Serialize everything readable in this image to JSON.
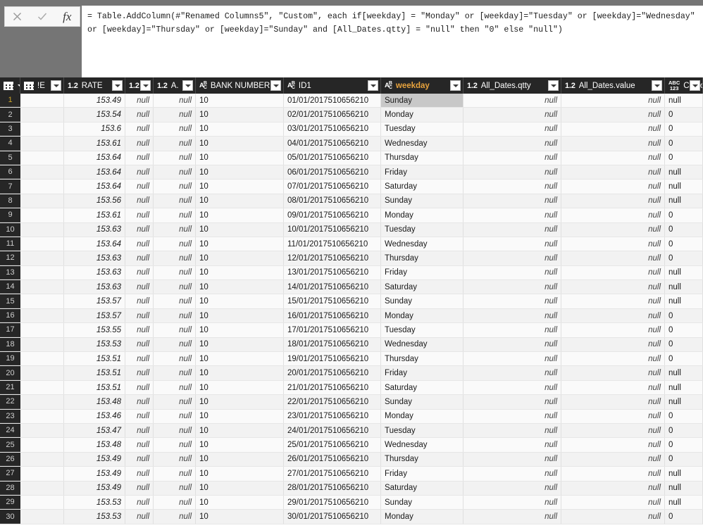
{
  "formula_bar": {
    "cancel_icon": "close-icon",
    "accept_icon": "check-icon",
    "fx_label": "fx",
    "formula": "= Table.AddColumn(#\"Renamed Columns5\", \"Custom\", each if[weekday] = \"Monday\" or [weekday]=\"Tuesday\" or [weekday]=\"Wednesday\" or [weekday]=\"Thursday\" or [weekday]=\"Sunday\" and [All_Dates.qtty] = \"null\" then \"0\" else \"null\")"
  },
  "grid": {
    "table_icon": "table-icon",
    "columns": [
      {
        "key": "rownum",
        "label": "",
        "type_badge": "",
        "width": 29,
        "align": "center",
        "selected": false,
        "dropdown": false
      },
      {
        "key": "c_date",
        "label": "!E",
        "type_badge": "table",
        "width": 62,
        "align": "left",
        "selected": false,
        "dropdown": true
      },
      {
        "key": "rate",
        "label": "RATE",
        "type_badge": "1.2",
        "width": 87,
        "align": "right",
        "selected": false,
        "dropdown": true
      },
      {
        "key": "narrow1",
        "label": "",
        "type_badge": "1.2",
        "width": 40,
        "align": "right",
        "selected": false,
        "dropdown": true
      },
      {
        "key": "narrow2",
        "label": "A.",
        "type_badge": "1.2",
        "width": 60,
        "align": "right",
        "selected": false,
        "dropdown": true
      },
      {
        "key": "bank",
        "label": "BANK NUMBER",
        "type_badge": "abc",
        "width": 125,
        "align": "left",
        "selected": false,
        "dropdown": true
      },
      {
        "key": "id1",
        "label": "ID1",
        "type_badge": "abc",
        "width": 138,
        "align": "left",
        "selected": false,
        "dropdown": true
      },
      {
        "key": "weekday",
        "label": "weekday",
        "type_badge": "abc",
        "width": 117,
        "align": "left",
        "selected": true,
        "dropdown": true
      },
      {
        "key": "qtty",
        "label": "All_Dates.qtty",
        "type_badge": "1.2",
        "width": 139,
        "align": "right",
        "selected": false,
        "dropdown": true
      },
      {
        "key": "value",
        "label": "All_Dates.value",
        "type_badge": "1.2",
        "width": 147,
        "align": "right",
        "selected": false,
        "dropdown": true
      },
      {
        "key": "custom",
        "label": "Custom",
        "type_badge": "abc123",
        "width": 54,
        "align": "left",
        "selected": false,
        "dropdown": true
      }
    ],
    "selected_cell": {
      "row": 1,
      "column": "weekday"
    },
    "rows": [
      {
        "rownum": "1",
        "c_date": "",
        "rate": "153.49",
        "narrow1": "null",
        "narrow2": "null",
        "bank": "10",
        "id1": "01/01/2017510656210",
        "weekday": "Sunday",
        "qtty": "null",
        "value": "null",
        "custom": "null"
      },
      {
        "rownum": "2",
        "c_date": "",
        "rate": "153.54",
        "narrow1": "null",
        "narrow2": "null",
        "bank": "10",
        "id1": "02/01/2017510656210",
        "weekday": "Monday",
        "qtty": "null",
        "value": "null",
        "custom": "0"
      },
      {
        "rownum": "3",
        "c_date": "",
        "rate": "153.6",
        "narrow1": "null",
        "narrow2": "null",
        "bank": "10",
        "id1": "03/01/2017510656210",
        "weekday": "Tuesday",
        "qtty": "null",
        "value": "null",
        "custom": "0"
      },
      {
        "rownum": "4",
        "c_date": "",
        "rate": "153.61",
        "narrow1": "null",
        "narrow2": "null",
        "bank": "10",
        "id1": "04/01/2017510656210",
        "weekday": "Wednesday",
        "qtty": "null",
        "value": "null",
        "custom": "0"
      },
      {
        "rownum": "5",
        "c_date": "",
        "rate": "153.64",
        "narrow1": "null",
        "narrow2": "null",
        "bank": "10",
        "id1": "05/01/2017510656210",
        "weekday": "Thursday",
        "qtty": "null",
        "value": "null",
        "custom": "0"
      },
      {
        "rownum": "6",
        "c_date": "",
        "rate": "153.64",
        "narrow1": "null",
        "narrow2": "null",
        "bank": "10",
        "id1": "06/01/2017510656210",
        "weekday": "Friday",
        "qtty": "null",
        "value": "null",
        "custom": "null"
      },
      {
        "rownum": "7",
        "c_date": "",
        "rate": "153.64",
        "narrow1": "null",
        "narrow2": "null",
        "bank": "10",
        "id1": "07/01/2017510656210",
        "weekday": "Saturday",
        "qtty": "null",
        "value": "null",
        "custom": "null"
      },
      {
        "rownum": "8",
        "c_date": "",
        "rate": "153.56",
        "narrow1": "null",
        "narrow2": "null",
        "bank": "10",
        "id1": "08/01/2017510656210",
        "weekday": "Sunday",
        "qtty": "null",
        "value": "null",
        "custom": "null"
      },
      {
        "rownum": "9",
        "c_date": "",
        "rate": "153.61",
        "narrow1": "null",
        "narrow2": "null",
        "bank": "10",
        "id1": "09/01/2017510656210",
        "weekday": "Monday",
        "qtty": "null",
        "value": "null",
        "custom": "0"
      },
      {
        "rownum": "10",
        "c_date": "",
        "rate": "153.63",
        "narrow1": "null",
        "narrow2": "null",
        "bank": "10",
        "id1": "10/01/2017510656210",
        "weekday": "Tuesday",
        "qtty": "null",
        "value": "null",
        "custom": "0"
      },
      {
        "rownum": "11",
        "c_date": "",
        "rate": "153.64",
        "narrow1": "null",
        "narrow2": "null",
        "bank": "10",
        "id1": "11/01/2017510656210",
        "weekday": "Wednesday",
        "qtty": "null",
        "value": "null",
        "custom": "0"
      },
      {
        "rownum": "12",
        "c_date": "",
        "rate": "153.63",
        "narrow1": "null",
        "narrow2": "null",
        "bank": "10",
        "id1": "12/01/2017510656210",
        "weekday": "Thursday",
        "qtty": "null",
        "value": "null",
        "custom": "0"
      },
      {
        "rownum": "13",
        "c_date": "",
        "rate": "153.63",
        "narrow1": "null",
        "narrow2": "null",
        "bank": "10",
        "id1": "13/01/2017510656210",
        "weekday": "Friday",
        "qtty": "null",
        "value": "null",
        "custom": "null"
      },
      {
        "rownum": "14",
        "c_date": "",
        "rate": "153.63",
        "narrow1": "null",
        "narrow2": "null",
        "bank": "10",
        "id1": "14/01/2017510656210",
        "weekday": "Saturday",
        "qtty": "null",
        "value": "null",
        "custom": "null"
      },
      {
        "rownum": "15",
        "c_date": "",
        "rate": "153.57",
        "narrow1": "null",
        "narrow2": "null",
        "bank": "10",
        "id1": "15/01/2017510656210",
        "weekday": "Sunday",
        "qtty": "null",
        "value": "null",
        "custom": "null"
      },
      {
        "rownum": "16",
        "c_date": "",
        "rate": "153.57",
        "narrow1": "null",
        "narrow2": "null",
        "bank": "10",
        "id1": "16/01/2017510656210",
        "weekday": "Monday",
        "qtty": "null",
        "value": "null",
        "custom": "0"
      },
      {
        "rownum": "17",
        "c_date": "",
        "rate": "153.55",
        "narrow1": "null",
        "narrow2": "null",
        "bank": "10",
        "id1": "17/01/2017510656210",
        "weekday": "Tuesday",
        "qtty": "null",
        "value": "null",
        "custom": "0"
      },
      {
        "rownum": "18",
        "c_date": "",
        "rate": "153.53",
        "narrow1": "null",
        "narrow2": "null",
        "bank": "10",
        "id1": "18/01/2017510656210",
        "weekday": "Wednesday",
        "qtty": "null",
        "value": "null",
        "custom": "0"
      },
      {
        "rownum": "19",
        "c_date": "",
        "rate": "153.51",
        "narrow1": "null",
        "narrow2": "null",
        "bank": "10",
        "id1": "19/01/2017510656210",
        "weekday": "Thursday",
        "qtty": "null",
        "value": "null",
        "custom": "0"
      },
      {
        "rownum": "20",
        "c_date": "",
        "rate": "153.51",
        "narrow1": "null",
        "narrow2": "null",
        "bank": "10",
        "id1": "20/01/2017510656210",
        "weekday": "Friday",
        "qtty": "null",
        "value": "null",
        "custom": "null"
      },
      {
        "rownum": "21",
        "c_date": "",
        "rate": "153.51",
        "narrow1": "null",
        "narrow2": "null",
        "bank": "10",
        "id1": "21/01/2017510656210",
        "weekday": "Saturday",
        "qtty": "null",
        "value": "null",
        "custom": "null"
      },
      {
        "rownum": "22",
        "c_date": "",
        "rate": "153.48",
        "narrow1": "null",
        "narrow2": "null",
        "bank": "10",
        "id1": "22/01/2017510656210",
        "weekday": "Sunday",
        "qtty": "null",
        "value": "null",
        "custom": "null"
      },
      {
        "rownum": "23",
        "c_date": "",
        "rate": "153.46",
        "narrow1": "null",
        "narrow2": "null",
        "bank": "10",
        "id1": "23/01/2017510656210",
        "weekday": "Monday",
        "qtty": "null",
        "value": "null",
        "custom": "0"
      },
      {
        "rownum": "24",
        "c_date": "",
        "rate": "153.47",
        "narrow1": "null",
        "narrow2": "null",
        "bank": "10",
        "id1": "24/01/2017510656210",
        "weekday": "Tuesday",
        "qtty": "null",
        "value": "null",
        "custom": "0"
      },
      {
        "rownum": "25",
        "c_date": "",
        "rate": "153.48",
        "narrow1": "null",
        "narrow2": "null",
        "bank": "10",
        "id1": "25/01/2017510656210",
        "weekday": "Wednesday",
        "qtty": "null",
        "value": "null",
        "custom": "0"
      },
      {
        "rownum": "26",
        "c_date": "",
        "rate": "153.49",
        "narrow1": "null",
        "narrow2": "null",
        "bank": "10",
        "id1": "26/01/2017510656210",
        "weekday": "Thursday",
        "qtty": "null",
        "value": "null",
        "custom": "0"
      },
      {
        "rownum": "27",
        "c_date": "",
        "rate": "153.49",
        "narrow1": "null",
        "narrow2": "null",
        "bank": "10",
        "id1": "27/01/2017510656210",
        "weekday": "Friday",
        "qtty": "null",
        "value": "null",
        "custom": "null"
      },
      {
        "rownum": "28",
        "c_date": "",
        "rate": "153.49",
        "narrow1": "null",
        "narrow2": "null",
        "bank": "10",
        "id1": "28/01/2017510656210",
        "weekday": "Saturday",
        "qtty": "null",
        "value": "null",
        "custom": "null"
      },
      {
        "rownum": "29",
        "c_date": "",
        "rate": "153.53",
        "narrow1": "null",
        "narrow2": "null",
        "bank": "10",
        "id1": "29/01/2017510656210",
        "weekday": "Sunday",
        "qtty": "null",
        "value": "null",
        "custom": "null"
      },
      {
        "rownum": "30",
        "c_date": "",
        "rate": "153.53",
        "narrow1": "null",
        "narrow2": "null",
        "bank": "10",
        "id1": "30/01/2017510656210",
        "weekday": "Monday",
        "qtty": "null",
        "value": "null",
        "custom": "0"
      }
    ]
  },
  "colors": {
    "header_bg": "#262626",
    "panel_bg": "#757575",
    "selected_column_text": "#e8a33d",
    "selected_cell_bg": "#c8c8c8",
    "row_bg": "#fafafa",
    "row_alt_bg": "#f2f2f2"
  }
}
